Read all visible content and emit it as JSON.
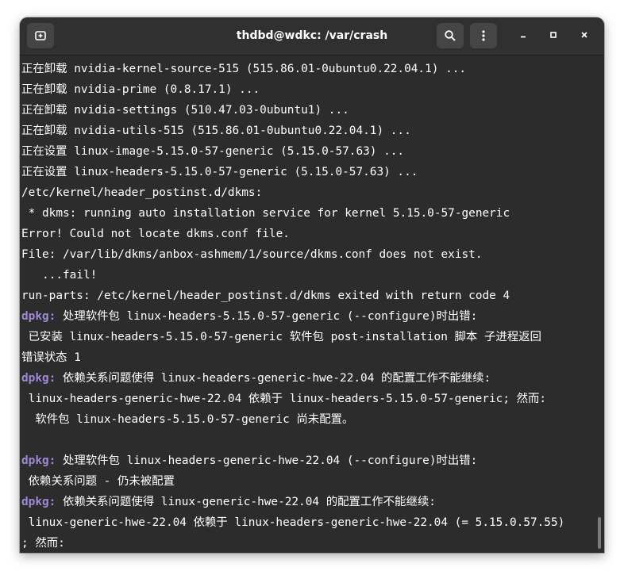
{
  "window": {
    "title": "thdbd@wdkc: /var/crash"
  },
  "icons": {
    "new_tab": "new-tab-icon",
    "search": "search-icon",
    "menu": "kebab-menu-icon",
    "minimize": "minimize-icon",
    "maximize": "maximize-icon",
    "close": "close-icon"
  },
  "colors": {
    "background": "#2c2c2c",
    "text": "#ffffff",
    "dpkg_tag": "#a08ad8",
    "headerbar": "#303030"
  },
  "terminal": {
    "lines": [
      {
        "prefix": "",
        "text": "正在卸载 nvidia-kernel-source-515 (515.86.01-0ubuntu0.22.04.1) ..."
      },
      {
        "prefix": "",
        "text": "正在卸载 nvidia-prime (0.8.17.1) ..."
      },
      {
        "prefix": "",
        "text": "正在卸载 nvidia-settings (510.47.03-0ubuntu1) ..."
      },
      {
        "prefix": "",
        "text": "正在卸载 nvidia-utils-515 (515.86.01-0ubuntu0.22.04.1) ..."
      },
      {
        "prefix": "",
        "text": "正在设置 linux-image-5.15.0-57-generic (5.15.0-57.63) ..."
      },
      {
        "prefix": "",
        "text": "正在设置 linux-headers-5.15.0-57-generic (5.15.0-57.63) ..."
      },
      {
        "prefix": "",
        "text": "/etc/kernel/header_postinst.d/dkms:"
      },
      {
        "prefix": "",
        "text": " * dkms: running auto installation service for kernel 5.15.0-57-generic"
      },
      {
        "prefix": "",
        "text": "Error! Could not locate dkms.conf file."
      },
      {
        "prefix": "",
        "text": "File: /var/lib/dkms/anbox-ashmem/1/source/dkms.conf does not exist."
      },
      {
        "prefix": "",
        "text": "   ...fail!"
      },
      {
        "prefix": "",
        "text": "run-parts: /etc/kernel/header_postinst.d/dkms exited with return code 4"
      },
      {
        "prefix": "dpkg:",
        "text": " 处理软件包 linux-headers-5.15.0-57-generic (--configure)时出错:"
      },
      {
        "prefix": "",
        "text": " 已安装 linux-headers-5.15.0-57-generic 软件包 post-installation 脚本 子进程返回"
      },
      {
        "prefix": "",
        "text": "错误状态 1"
      },
      {
        "prefix": "dpkg:",
        "text": " 依赖关系问题使得 linux-headers-generic-hwe-22.04 的配置工作不能继续:"
      },
      {
        "prefix": "",
        "text": " linux-headers-generic-hwe-22.04 依赖于 linux-headers-5.15.0-57-generic; 然而:"
      },
      {
        "prefix": "",
        "text": "  软件包 linux-headers-5.15.0-57-generic 尚未配置。"
      },
      {
        "prefix": "",
        "text": ""
      },
      {
        "prefix": "dpkg:",
        "text": " 处理软件包 linux-headers-generic-hwe-22.04 (--configure)时出错:"
      },
      {
        "prefix": "",
        "text": " 依赖关系问题 - 仍未被配置"
      },
      {
        "prefix": "dpkg:",
        "text": " 依赖关系问题使得 linux-generic-hwe-22.04 的配置工作不能继续:"
      },
      {
        "prefix": "",
        "text": " linux-generic-hwe-22.04 依赖于 linux-headers-generic-hwe-22.04 (= 5.15.0.57.55)"
      },
      {
        "prefix": "",
        "text": "; 然而:"
      }
    ]
  }
}
